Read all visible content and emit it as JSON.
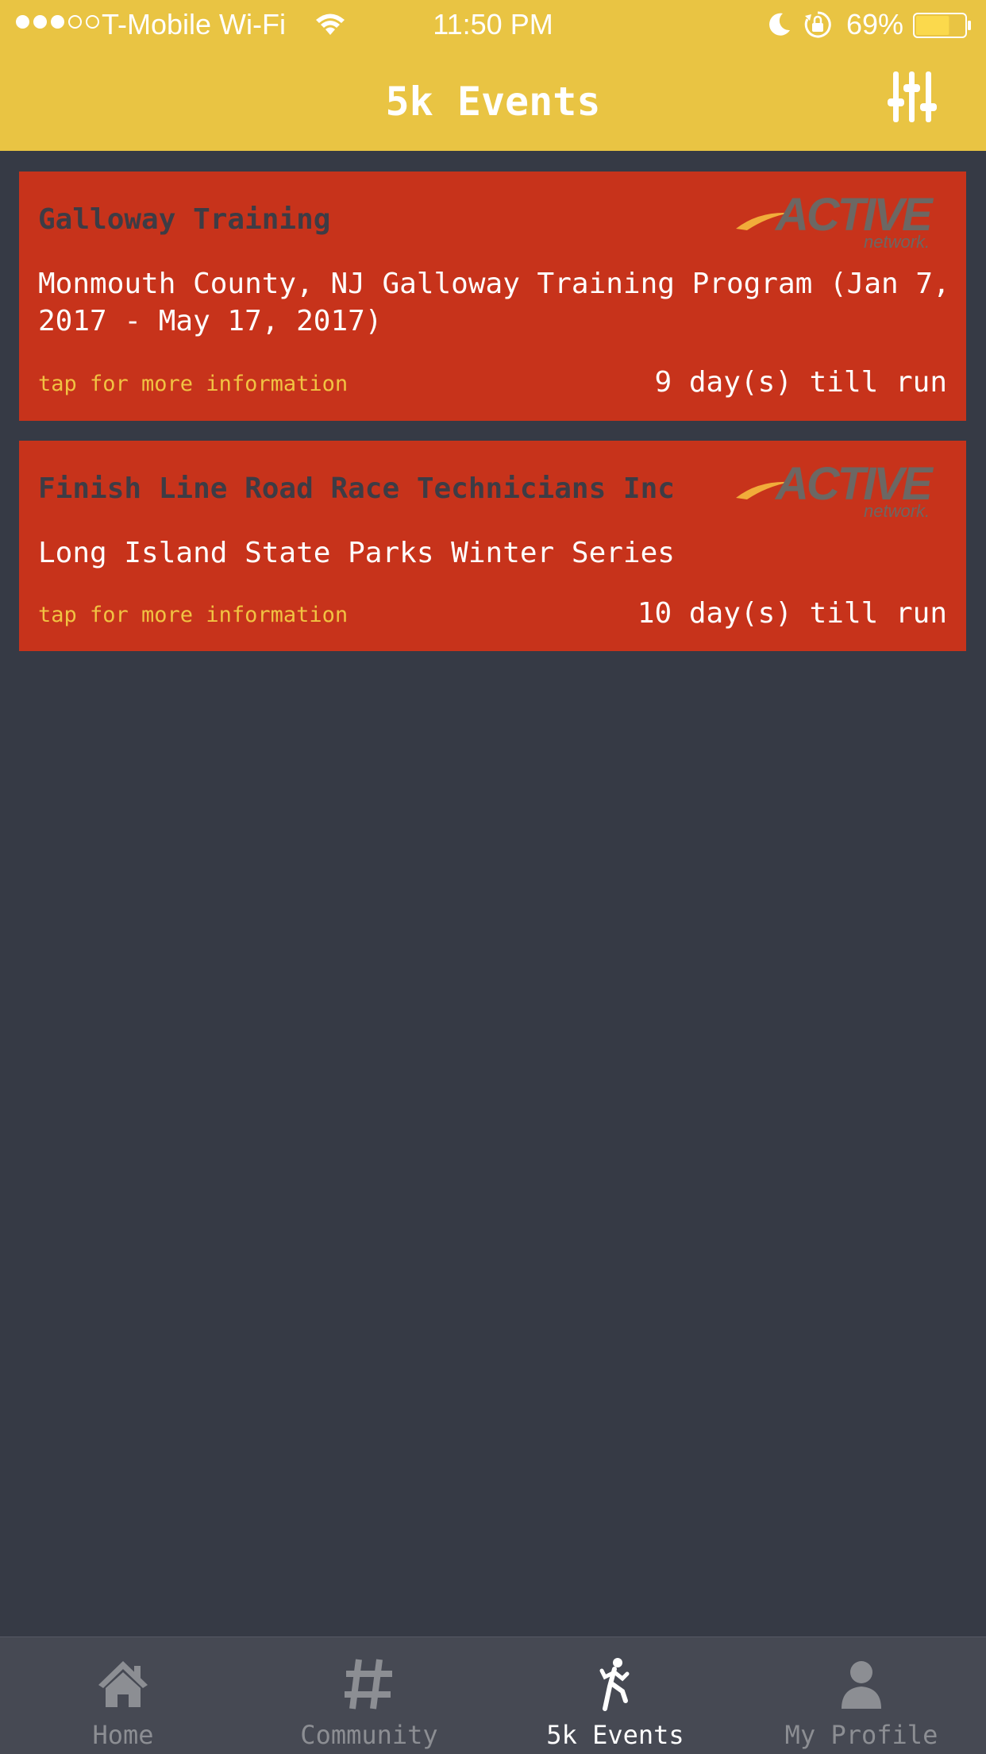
{
  "status_bar": {
    "carrier": "T-Mobile Wi-Fi",
    "time": "11:50 PM",
    "battery": "69%",
    "battery_level": 0.69,
    "signal_bars": 3,
    "signal_total": 5
  },
  "header": {
    "title": "5k Events",
    "background_color": "#e9c443",
    "filter_icon": "sliders-icon"
  },
  "events": [
    {
      "organizer": "Galloway Training",
      "description": "Monmouth County, NJ Galloway Training Program (Jan 7, 2017 - May 17, 2017)",
      "tap_hint": "tap for more information",
      "countdown": "9 day(s) till run",
      "logo": "active-network-logo"
    },
    {
      "organizer": "Finish Line Road Race Technicians Inc",
      "description": "Long Island State Parks Winter Series",
      "tap_hint": "tap for more information",
      "countdown": "10 day(s) till run",
      "logo": "active-network-logo"
    }
  ],
  "colors": {
    "card": "#c7331b",
    "background": "#363a45",
    "tabbar": "#464953",
    "accent_yellow": "#f1c342"
  },
  "tabbar": {
    "tabs": [
      {
        "label": "Home",
        "icon": "home-icon",
        "active": false
      },
      {
        "label": "Community",
        "icon": "hashtag-icon",
        "active": false
      },
      {
        "label": "5k Events",
        "icon": "runner-icon",
        "active": true
      },
      {
        "label": "My Profile",
        "icon": "person-icon",
        "active": false
      }
    ]
  }
}
